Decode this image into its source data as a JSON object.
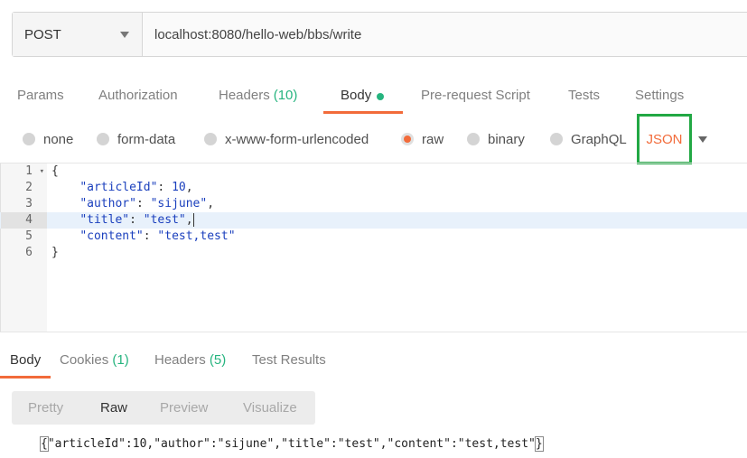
{
  "request": {
    "method": "POST",
    "url": "localhost:8080/hello-web/bbs/write"
  },
  "request_tabs": [
    {
      "label": "Params"
    },
    {
      "label": "Authorization"
    },
    {
      "label": "Headers",
      "count": "(10)"
    },
    {
      "label": "Body"
    },
    {
      "label": "Pre-request Script"
    },
    {
      "label": "Tests"
    },
    {
      "label": "Settings"
    }
  ],
  "body_types": [
    {
      "label": "none"
    },
    {
      "label": "form-data"
    },
    {
      "label": "x-www-form-urlencoded"
    },
    {
      "label": "raw",
      "selected": true
    },
    {
      "label": "binary"
    },
    {
      "label": "GraphQL"
    }
  ],
  "raw_format": "JSON",
  "editor": {
    "line_numbers": [
      "1",
      "2",
      "3",
      "4",
      "5",
      "6"
    ],
    "highlight_line": 4
  },
  "response_tabs": [
    {
      "label": "Body"
    },
    {
      "label": "Cookies",
      "count": "(1)"
    },
    {
      "label": "Headers",
      "count": "(5)"
    },
    {
      "label": "Test Results"
    }
  ],
  "view_modes": [
    "Pretty",
    "Raw",
    "Preview",
    "Visualize"
  ],
  "active_view": "Raw",
  "response_body": "{\"articleId\":10,\"author\":\"sijune\",\"title\":\"test\",\"content\":\"test,test\"}",
  "colors": {
    "accent": "#f26b3a",
    "count": "#26b47f",
    "highlight_box": "#22a844"
  }
}
